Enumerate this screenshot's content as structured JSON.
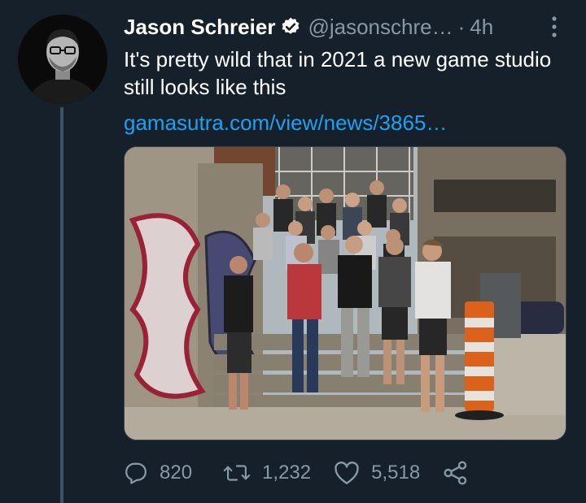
{
  "tweet": {
    "author_name": "Jason Schreier",
    "handle": "@jasonschre…",
    "separator": "·",
    "time": "4h",
    "text": "It's pretty wild that in 2021 a new game studio still looks like this",
    "link": "gamasutra.com/view/news/3865…"
  },
  "actions": {
    "reply_count": "820",
    "retweet_count": "1,232",
    "like_count": "5,518"
  },
  "icons": {
    "verified": "verified-badge-icon",
    "more": "more-vertical-icon",
    "reply": "reply-icon",
    "retweet": "retweet-icon",
    "like": "heart-icon",
    "share": "share-icon"
  },
  "colors": {
    "background": "#15202b",
    "link": "#1da1f2",
    "secondary_text": "#8899a6"
  }
}
